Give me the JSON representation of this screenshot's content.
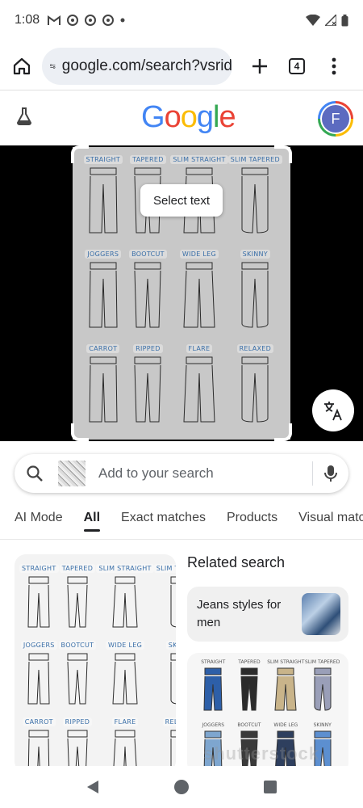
{
  "status_bar": {
    "time": "1:08"
  },
  "browser": {
    "url": "google.com/search?vsrid",
    "tab_count": "4"
  },
  "header": {
    "logo_letters": [
      "G",
      "o",
      "o",
      "g",
      "l",
      "e"
    ],
    "logo_colors": [
      "#4285f4",
      "#ea4335",
      "#fbbc05",
      "#4285f4",
      "#34a853",
      "#ea4335"
    ],
    "avatar_initial": "F"
  },
  "image_viewer": {
    "select_text_label": "Select text",
    "pants": [
      "STRAIGHT",
      "TAPERED",
      "SLIM STRAIGHT",
      "SLIM TAPERED",
      "JOGGERS",
      "BOOTCUT",
      "WIDE LEG",
      "SKINNY",
      "CARROT",
      "RIPPED",
      "FLARE",
      "RELAXED"
    ]
  },
  "search": {
    "placeholder": "Add to your search"
  },
  "tabs": [
    "AI Mode",
    "All",
    "Exact matches",
    "Products",
    "Visual matches"
  ],
  "active_tab": "All",
  "results": {
    "related_title": "Related search",
    "related_card_label": "Jeans styles for men",
    "color_chart": {
      "labels": [
        "STRAIGHT",
        "TAPERED",
        "SLIM STRAIGHT",
        "SLIM TAPERED",
        "JOGGERS",
        "BOOTCUT",
        "WIDE LEG",
        "SKINNY"
      ],
      "colors": [
        "#2d5fa8",
        "#2b2b2b",
        "#c9b48a",
        "#9a9fb8",
        "#7ea6cf",
        "#3a3a3a",
        "#2e3f5e",
        "#5c8fd0"
      ]
    },
    "watermark": "shutterstock"
  }
}
